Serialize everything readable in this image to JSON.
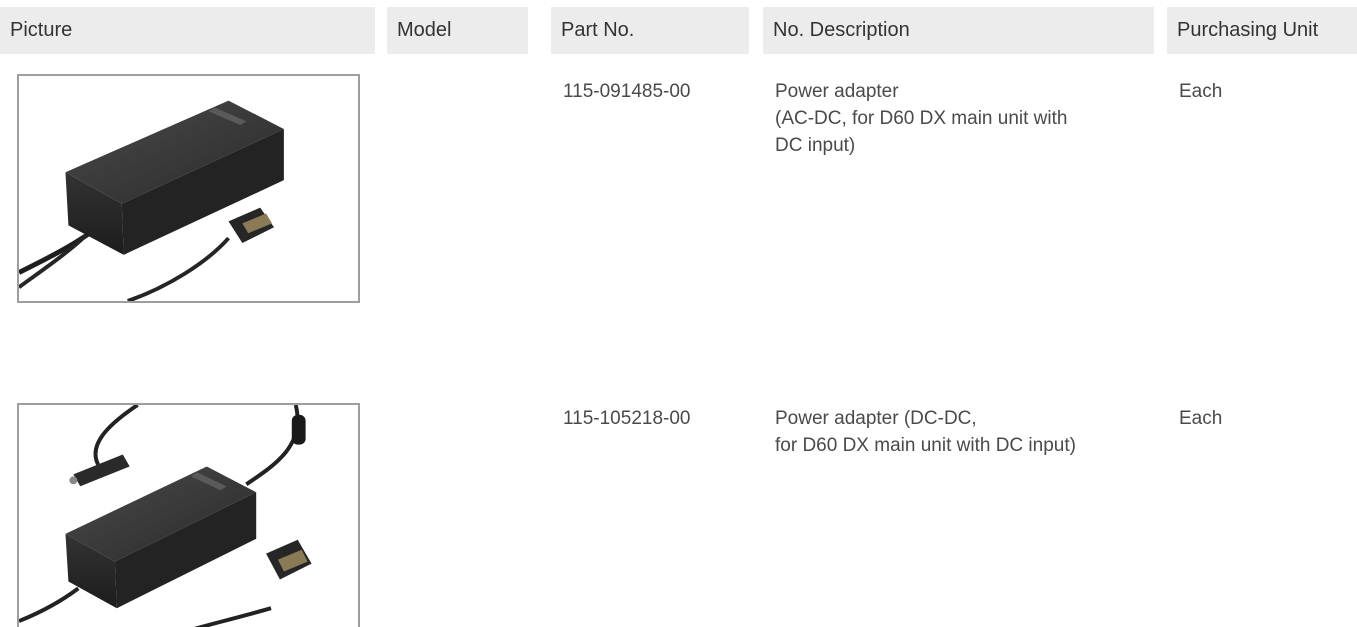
{
  "header": {
    "picture": "Picture",
    "model": "Model",
    "part_no": "Part No.",
    "description": "No. Description",
    "purchasing_unit": "Purchasing Unit"
  },
  "rows": [
    {
      "picture_icon": "ac-dc-power-adapter-image",
      "model": "",
      "part_no": "115-091485-00",
      "description_lines": [
        "Power adapter",
        "(AC-DC, for D60 DX main unit with",
        "DC input)"
      ],
      "purchasing_unit": "Each"
    },
    {
      "picture_icon": "dc-dc-power-adapter-image",
      "model": "",
      "part_no": "115-105218-00",
      "description_lines": [
        "Power adapter (DC-DC,",
        "for D60 DX main unit with DC input)"
      ],
      "purchasing_unit": "Each"
    }
  ],
  "colors": {
    "header_bg": "#ececec",
    "frame_border": "#9e9e9e",
    "text": "#4a4a4a"
  }
}
